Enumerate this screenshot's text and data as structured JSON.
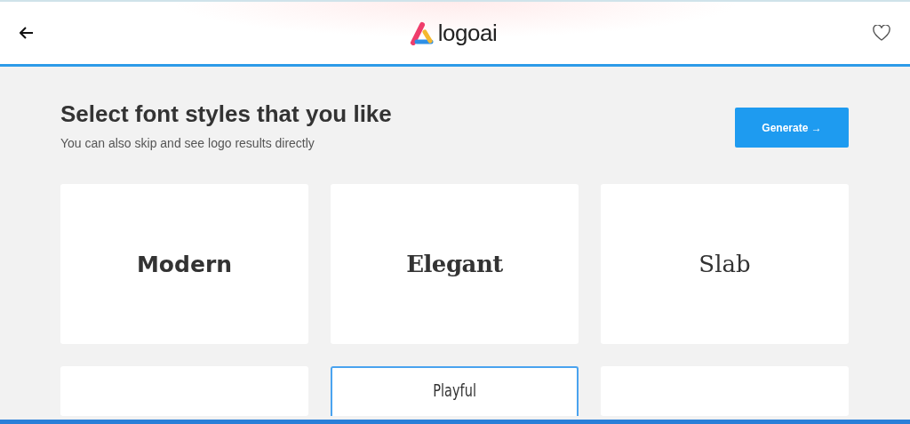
{
  "header": {
    "brand": "logoai"
  },
  "heading": {
    "title": "Select font styles that you like",
    "subtitle": "You can also skip and see logo results directly",
    "button": "Generate →"
  },
  "font_styles": [
    {
      "kind": "modern",
      "label": "Modern",
      "selected": false
    },
    {
      "kind": "elegant",
      "label": "Elegant",
      "selected": false
    },
    {
      "kind": "slab",
      "label": "Slab",
      "selected": false
    },
    {
      "kind": "blank",
      "selected": false
    },
    {
      "kind": "playful",
      "label": "Playful",
      "selected": true
    },
    {
      "kind": "blank",
      "selected": false
    }
  ]
}
